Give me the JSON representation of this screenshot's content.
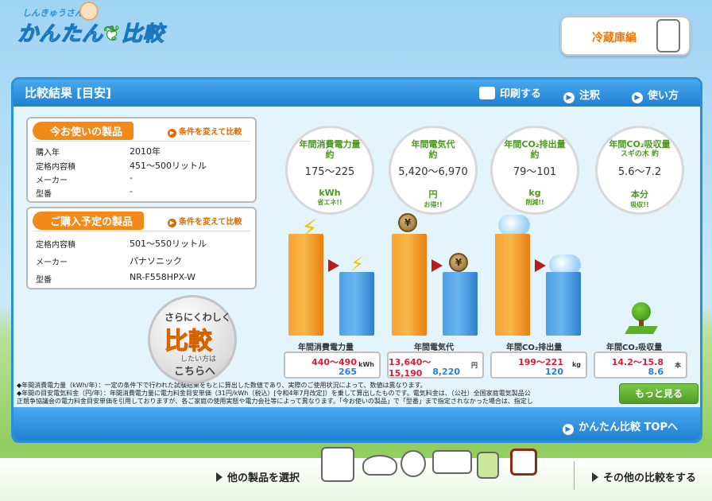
{
  "header": {
    "logo_top": "しんきゅうさん",
    "logo_main_1": "かんたん",
    "logo_main_2": "比較",
    "category": "冷蔵庫編"
  },
  "panel": {
    "title": "比較結果 [目安]",
    "print": "印刷する",
    "notes_link": "注釈",
    "howto": "使い方"
  },
  "current": {
    "title": "今お使いの製品",
    "change": "条件を変えて比較",
    "rows": [
      {
        "label": "購入年",
        "value": "2010年"
      },
      {
        "label": "定格内容積",
        "value": "451～500リットル"
      },
      {
        "label": "メーカー",
        "value": "-"
      },
      {
        "label": "型番",
        "value": "-"
      }
    ]
  },
  "planned": {
    "title": "ご購入予定の製品",
    "change": "条件を変えて比較",
    "rows": [
      {
        "label": "定格内容積",
        "value": "501～550リットル"
      },
      {
        "label": "メーカー",
        "value": "パナソニック"
      },
      {
        "label": "型番",
        "value": "NR-F558HPX-W"
      }
    ]
  },
  "detail_button": {
    "line1": "さらにくわしく",
    "line2": "比較",
    "line3": "したい方は",
    "line4": "こちらへ"
  },
  "stats": [
    {
      "label1": "年間消費電力量",
      "label2": "約",
      "value": "175～225",
      "unit": "kWh",
      "sub": "省エネ!!"
    },
    {
      "label1": "年間電気代",
      "label2": "約",
      "value": "5,420～6,970",
      "unit": "円",
      "sub": "お得!!"
    },
    {
      "label1": "年間CO₂排出量",
      "label2": "約",
      "value": "79～101",
      "unit": "kg",
      "sub": "削減!!"
    },
    {
      "label1": "年間CO₂吸収量",
      "label2": "スギの木 約",
      "value": "5.6～7.2",
      "unit": "本分",
      "sub": "吸収!!"
    }
  ],
  "categories": [
    {
      "label": "年間消費電力量",
      "current": "440～490",
      "planned": "265",
      "unit": "kWh"
    },
    {
      "label": "年間電気代",
      "current": "13,640～15,190",
      "planned": "8,220",
      "unit": "円"
    },
    {
      "label": "年間CO₂排出量",
      "current": "199～221",
      "planned": "120",
      "unit": "kg"
    },
    {
      "label": "年間CO₂吸収量",
      "current": "14.2～15.8",
      "planned": "8.6",
      "unit": "本"
    }
  ],
  "coin_symbol": "¥",
  "notes": [
    "◆年間消費電力量（kWh/年）：一定の条件下で行われた試験結果をもとに算出した数値であり、実際のご使用状況によって、数値は異なります。",
    "◆年間の目安電気料金（円/年）：年間消費電力量に電力料金目安単価（31円/kWh（税込）[令和4年7月改定]）を乗して算出したものです。電気料金は、（公社）全国家庭電気製品公",
    "正競争協議会の電力料金目安単価を引用しておりますが、各ご家庭の使用実態や電力会社等によって異なります。「今お使いの製品」で「型番」まで指定されなかった場合は、指定し"
  ],
  "more": "もっと見る",
  "top_link": "かんたん比較 TOPへ",
  "bottom": {
    "left": "他の製品を選択",
    "right": "その他の比較をする"
  },
  "colors": {
    "accent_blue": "#1f7fd0",
    "orange": "#f28a1a",
    "green": "#4a9a1a",
    "red_value": "#d6203a"
  }
}
